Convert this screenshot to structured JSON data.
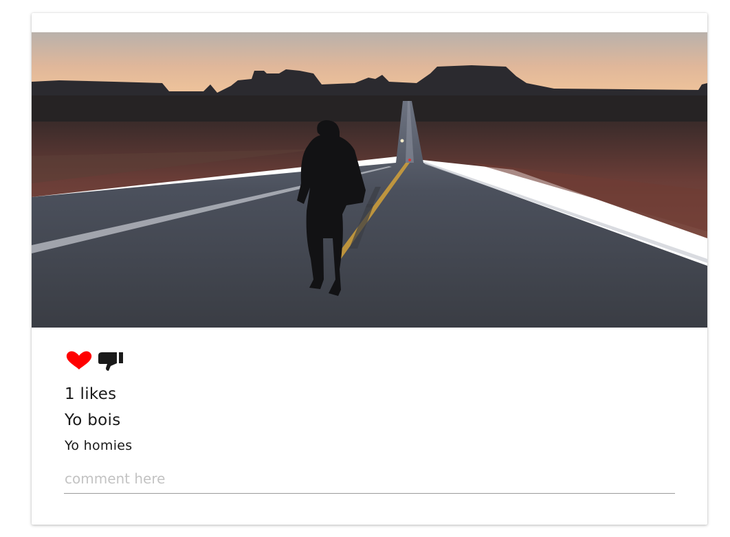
{
  "post": {
    "image_alt": "",
    "likes_text": "1 likes",
    "title": "Yo bois",
    "caption": "Yo homies"
  },
  "actions": {
    "like_icon": "heart-icon",
    "dislike_icon": "thumbs-down-icon",
    "like_color": "#ff0000",
    "dislike_color": "#1a1a1a"
  },
  "comment": {
    "placeholder": "comment here",
    "value": ""
  }
}
